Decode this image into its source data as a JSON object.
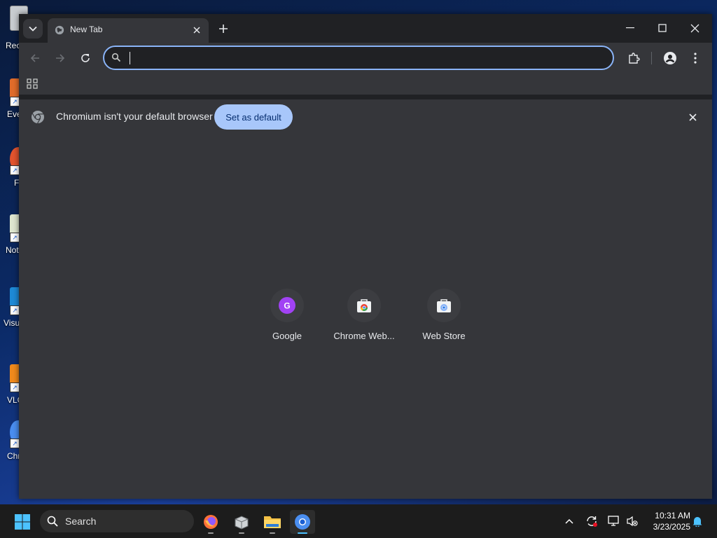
{
  "desktop": {
    "icons": [
      {
        "label": "Rec"
      },
      {
        "label": "Eve"
      },
      {
        "label": "F"
      },
      {
        "label": "Not"
      },
      {
        "label": "Visu"
      },
      {
        "label": "VLC"
      },
      {
        "label": "Chr"
      }
    ]
  },
  "browser": {
    "tab": {
      "title": "New Tab",
      "icon": "globe-icon"
    },
    "omnibox": {
      "value": ""
    },
    "infobar": {
      "message": "Chromium isn't your default browser",
      "button_label": "Set as default"
    },
    "shortcuts": [
      {
        "name": "Google",
        "icon_letter": "G"
      },
      {
        "name": "Chrome Web...",
        "icon": "webstore-icon"
      },
      {
        "name": "Web Store",
        "icon": "webstore-icon"
      }
    ],
    "colors": {
      "accent": "#8ab4f8",
      "set_default_bg": "#a8c7fa",
      "google_avatar": "#a142f4"
    }
  },
  "taskbar": {
    "search_label": "Search",
    "time": "10:31 AM",
    "date": "3/23/2025"
  }
}
